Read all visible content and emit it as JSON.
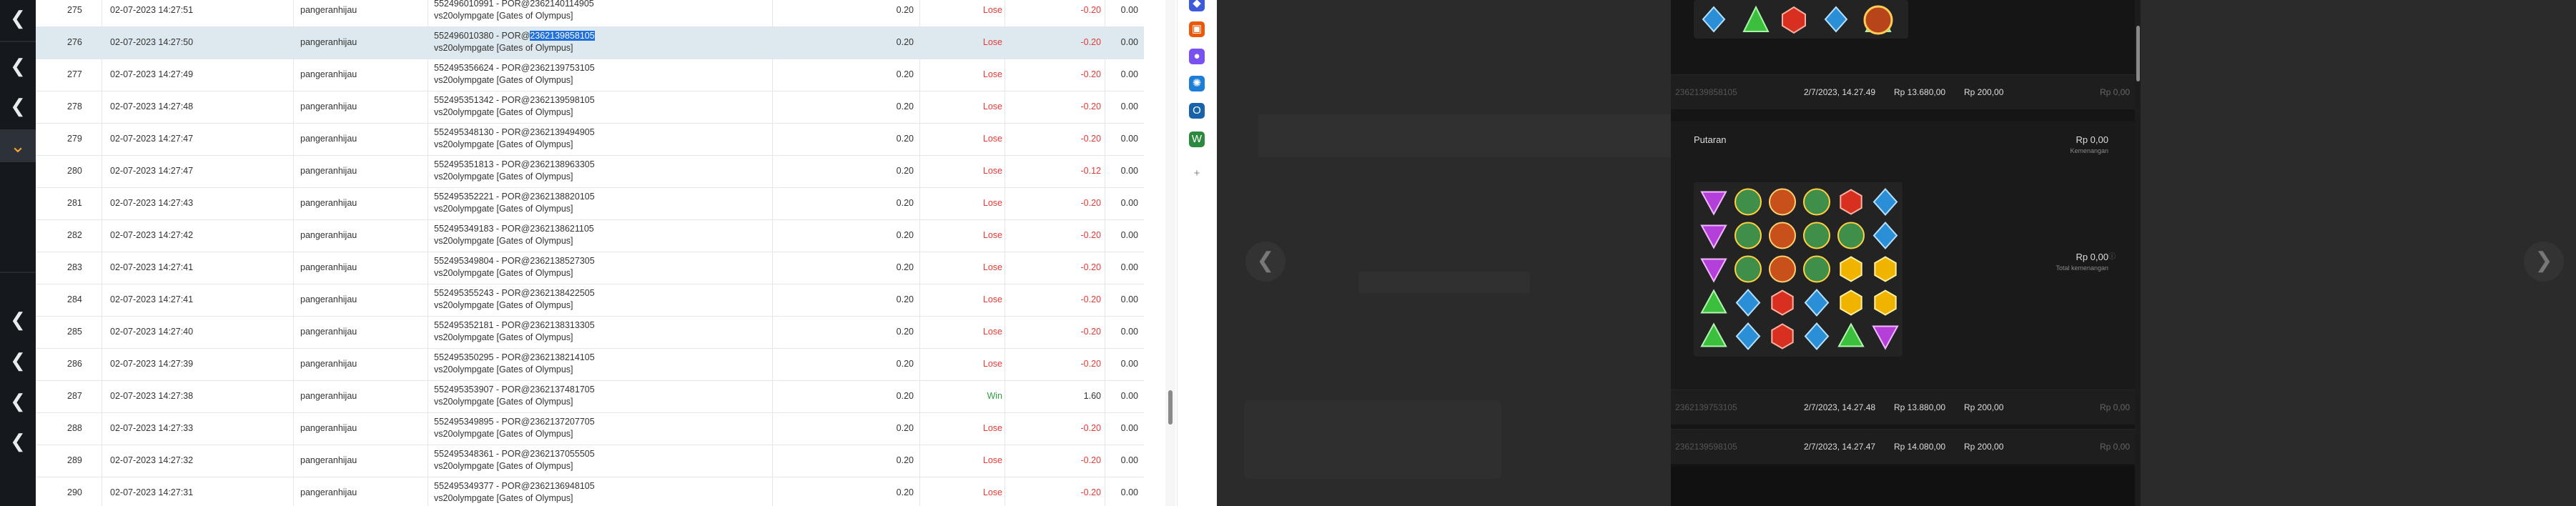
{
  "left_bar": {
    "buttons": [
      "❮",
      "❮",
      "❮",
      "⌄",
      "❮",
      "❮",
      "❮",
      "❮"
    ]
  },
  "table": {
    "rows": [
      {
        "no": "275",
        "date": "02-07-2023 14:27:51",
        "user": "pangeranhijau",
        "desc1": "552496010991 - POR@2362140114905",
        "desc2": "vs20olympgate [Gates of Olympus]",
        "bet": "0.20",
        "result": "Lose",
        "amount": "-0.20",
        "balance": "0.00"
      },
      {
        "no": "276",
        "date": "02-07-2023 14:27:50",
        "user": "pangeranhijau",
        "desc1a": "552496010380 - POR@",
        "desc1b": "2362139858105",
        "desc2": "vs20olympgate [Gates of Olympus]",
        "bet": "0.20",
        "result": "Lose",
        "amount": "-0.20",
        "balance": "0.00"
      },
      {
        "no": "277",
        "date": "02-07-2023 14:27:49",
        "user": "pangeranhijau",
        "desc1": "552495356624 - POR@2362139753105",
        "desc2": "vs20olympgate [Gates of Olympus]",
        "bet": "0.20",
        "result": "Lose",
        "amount": "-0.20",
        "balance": "0.00"
      },
      {
        "no": "278",
        "date": "02-07-2023 14:27:48",
        "user": "pangeranhijau",
        "desc1": "552495351342 - POR@2362139598105",
        "desc2": "vs20olympgate [Gates of Olympus]",
        "bet": "0.20",
        "result": "Lose",
        "amount": "-0.20",
        "balance": "0.00"
      },
      {
        "no": "279",
        "date": "02-07-2023 14:27:47",
        "user": "pangeranhijau",
        "desc1": "552495348130 - POR@2362139494905",
        "desc2": "vs20olympgate [Gates of Olympus]",
        "bet": "0.20",
        "result": "Lose",
        "amount": "-0.20",
        "balance": "0.00"
      },
      {
        "no": "280",
        "date": "02-07-2023 14:27:47",
        "user": "pangeranhijau",
        "desc1": "552495351813 - POR@2362138963305",
        "desc2": "vs20olympgate [Gates of Olympus]",
        "bet": "0.20",
        "result": "Lose",
        "amount": "-0.12",
        "balance": "0.00"
      },
      {
        "no": "281",
        "date": "02-07-2023 14:27:43",
        "user": "pangeranhijau",
        "desc1": "552495352221 - POR@2362138820105",
        "desc2": "vs20olympgate [Gates of Olympus]",
        "bet": "0.20",
        "result": "Lose",
        "amount": "-0.20",
        "balance": "0.00"
      },
      {
        "no": "282",
        "date": "02-07-2023 14:27:42",
        "user": "pangeranhijau",
        "desc1": "552495349183 - POR@2362138621105",
        "desc2": "vs20olympgate [Gates of Olympus]",
        "bet": "0.20",
        "result": "Lose",
        "amount": "-0.20",
        "balance": "0.00"
      },
      {
        "no": "283",
        "date": "02-07-2023 14:27:41",
        "user": "pangeranhijau",
        "desc1": "552495349804 - POR@2362138527305",
        "desc2": "vs20olympgate [Gates of Olympus]",
        "bet": "0.20",
        "result": "Lose",
        "amount": "-0.20",
        "balance": "0.00"
      },
      {
        "no": "284",
        "date": "02-07-2023 14:27:41",
        "user": "pangeranhijau",
        "desc1": "552495355243 - POR@2362138422505",
        "desc2": "vs20olympgate [Gates of Olympus]",
        "bet": "0.20",
        "result": "Lose",
        "amount": "-0.20",
        "balance": "0.00"
      },
      {
        "no": "285",
        "date": "02-07-2023 14:27:40",
        "user": "pangeranhijau",
        "desc1": "552495352181 - POR@2362138313305",
        "desc2": "vs20olympgate [Gates of Olympus]",
        "bet": "0.20",
        "result": "Lose",
        "amount": "-0.20",
        "balance": "0.00"
      },
      {
        "no": "286",
        "date": "02-07-2023 14:27:39",
        "user": "pangeranhijau",
        "desc1": "552495350295 - POR@2362138214105",
        "desc2": "vs20olympgate [Gates of Olympus]",
        "bet": "0.20",
        "result": "Lose",
        "amount": "-0.20",
        "balance": "0.00"
      },
      {
        "no": "287",
        "date": "02-07-2023 14:27:38",
        "user": "pangeranhijau",
        "desc1": "552495353907 - POR@2362137481705",
        "desc2": "vs20olympgate [Gates of Olympus]",
        "bet": "0.20",
        "result": "Win",
        "amount": "1.60",
        "balance": "0.00"
      },
      {
        "no": "288",
        "date": "02-07-2023 14:27:33",
        "user": "pangeranhijau",
        "desc1": "552495349895 - POR@2362137207705",
        "desc2": "vs20olympgate [Gates of Olympus]",
        "bet": "0.20",
        "result": "Lose",
        "amount": "-0.20",
        "balance": "0.00"
      },
      {
        "no": "289",
        "date": "02-07-2023 14:27:32",
        "user": "pangeranhijau",
        "desc1": "552495348361 - POR@2362137055505",
        "desc2": "vs20olympgate [Gates of Olympus]",
        "bet": "0.20",
        "result": "Lose",
        "amount": "-0.20",
        "balance": "0.00"
      },
      {
        "no": "290",
        "date": "02-07-2023 14:27:31",
        "user": "pangeranhijau",
        "desc1": "552495349377 - POR@2362136948105",
        "desc2": "vs20olympgate [Gates of Olympus]",
        "bet": "0.20",
        "result": "Lose",
        "amount": "-0.20",
        "balance": "0.00"
      }
    ]
  },
  "icon_strip": {
    "icons": [
      {
        "name": "diamond-icon",
        "glyph": "◆",
        "color": "#3b5bdb"
      },
      {
        "name": "toolbox-icon",
        "glyph": "▣",
        "color": "#e8590c"
      },
      {
        "name": "people-icon",
        "glyph": "●",
        "color": "#7950f2"
      },
      {
        "name": "copilot-icon",
        "glyph": "✺",
        "color": "#1c7ed6"
      },
      {
        "name": "outlook-icon",
        "glyph": "O",
        "color": "#1864ab"
      },
      {
        "name": "drop-icon",
        "glyph": "W",
        "color": "#2b8a3e"
      },
      {
        "name": "add-icon",
        "glyph": "+",
        "color": "#888888"
      }
    ]
  },
  "panel": {
    "top_row": {
      "id": "2362139858105",
      "date": "2/7/2023, 14.27.49",
      "balance": "Rp 13.680,00",
      "bet": "Rp 200,00",
      "win": "Rp 0,00"
    },
    "spin": {
      "title": "Putaran",
      "win_top": "Rp 0,00",
      "win_top_sub": "Kemenangan",
      "win_total": "Rp 0,00",
      "win_total_sub": "Total kemenangan"
    },
    "bottom_rows": [
      {
        "id": "2362139753105",
        "date": "2/7/2023, 14.27.48",
        "balance": "Rp 13.880,00",
        "bet": "Rp 200,00",
        "win": "Rp 0,00"
      },
      {
        "id": "2362139598105",
        "date": "2/7/2023, 14.27.47",
        "balance": "Rp 14.080,00",
        "bet": "Rp 200,00",
        "win": "Rp 0,00"
      }
    ]
  },
  "game": {
    "nav_left": "❮",
    "nav_right": "❯"
  }
}
